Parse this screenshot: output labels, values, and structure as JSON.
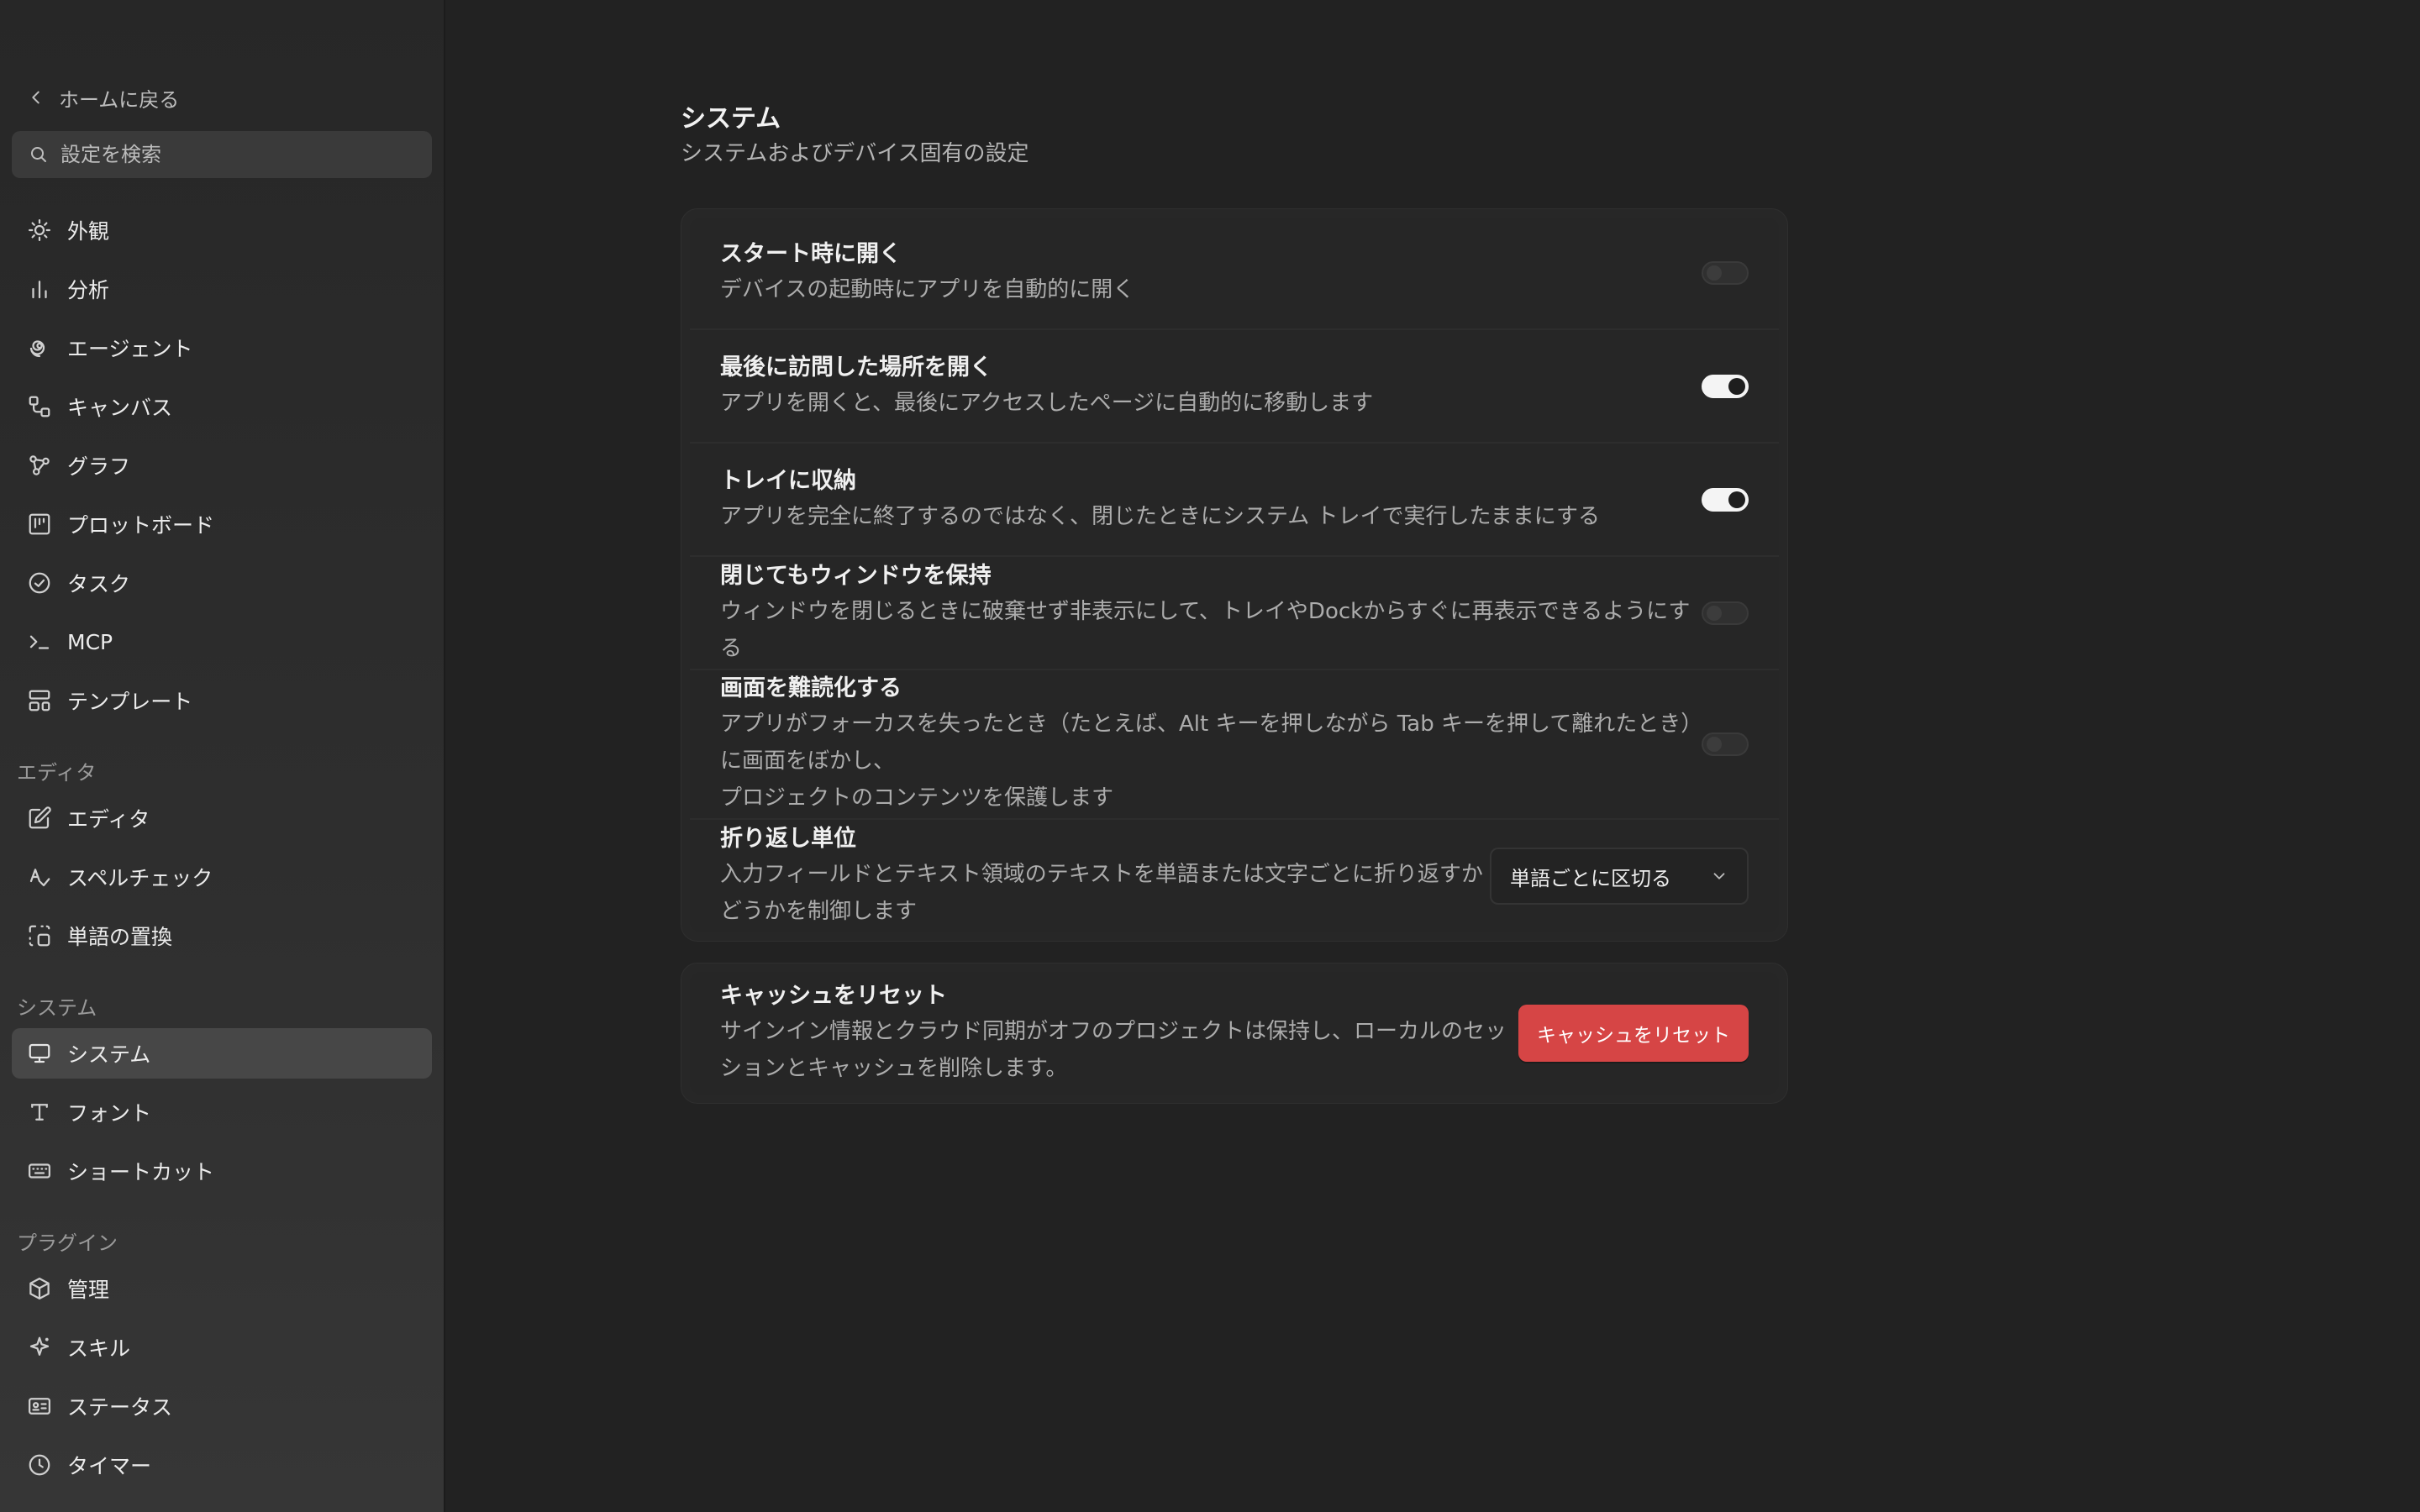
{
  "sidebar": {
    "back_label": "ホームに戻る",
    "search_placeholder": "設定を検索",
    "items": [
      {
        "label": "外観"
      },
      {
        "label": "分析"
      },
      {
        "label": "エージェント"
      },
      {
        "label": "キャンバス"
      },
      {
        "label": "グラフ"
      },
      {
        "label": "プロットボード"
      },
      {
        "label": "タスク"
      },
      {
        "label": "MCP"
      },
      {
        "label": "テンプレート"
      }
    ],
    "sections": [
      {
        "label": "エディタ",
        "items": [
          {
            "label": "エディタ"
          },
          {
            "label": "スペルチェック"
          },
          {
            "label": "単語の置換"
          }
        ]
      },
      {
        "label": "システム",
        "items": [
          {
            "label": "システム",
            "active": true
          },
          {
            "label": "フォント"
          },
          {
            "label": "ショートカット"
          }
        ]
      },
      {
        "label": "プラグイン",
        "items": [
          {
            "label": "管理"
          },
          {
            "label": "スキル"
          },
          {
            "label": "ステータス"
          },
          {
            "label": "タイマー"
          }
        ]
      }
    ]
  },
  "main": {
    "title": "システム",
    "subtitle": "システムおよびデバイス固有の設定",
    "settings": [
      {
        "title": "スタート時に開く",
        "desc": "デバイスの起動時にアプリを自動的に開く",
        "toggle": false
      },
      {
        "title": "最後に訪問した場所を開く",
        "desc": "アプリを開くと、最後にアクセスしたページに自動的に移動します",
        "toggle": true
      },
      {
        "title": "トレイに収納",
        "desc": "アプリを完全に終了するのではなく、閉じたときにシステム トレイで実行したままにする",
        "toggle": true
      },
      {
        "title": "閉じてもウィンドウを保持",
        "desc": "ウィンドウを閉じるときに破棄せず非表示にして、トレイやDockからすぐに再表示できるようにする",
        "toggle": false
      },
      {
        "title": "画面を難読化する",
        "desc_line1": "アプリがフォーカスを失ったとき（たとえば、Alt キーを押しながら Tab キーを押して離れたとき）に画面をぼかし、",
        "desc_line2": "プロジェクトのコンテンツを保護します",
        "toggle": false
      },
      {
        "title": "折り返し単位",
        "desc": "入力フィールドとテキスト領域のテキストを単語または文字ごとに折り返すかどうかを制御します",
        "select_value": "単語ごとに区切る"
      }
    ],
    "cache": {
      "title": "キャッシュをリセット",
      "desc": "サインイン情報とクラウド同期がオフのプロジェクトは保持し、ローカルのセッションとキャッシュを削除します。",
      "button_label": "キャッシュをリセット",
      "button_color": "#d64545"
    }
  }
}
